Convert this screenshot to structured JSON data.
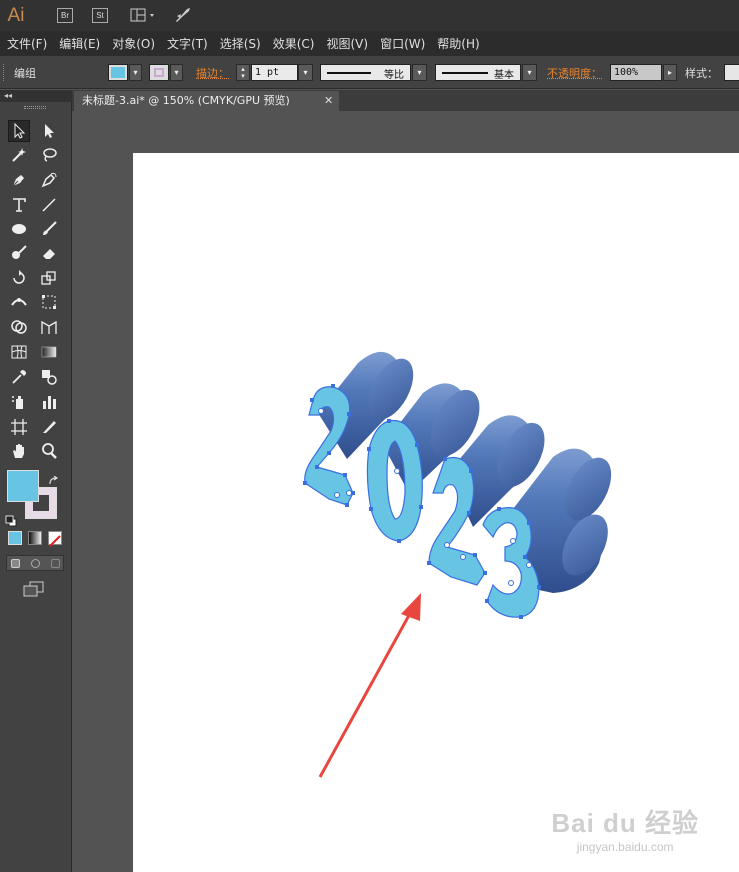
{
  "app": {
    "logo": "Ai",
    "bridge_label": "Br",
    "stock_label": "St"
  },
  "menu": [
    "文件(F)",
    "编辑(E)",
    "对象(O)",
    "文字(T)",
    "选择(S)",
    "效果(C)",
    "视图(V)",
    "窗口(W)",
    "帮助(H)"
  ],
  "control": {
    "group_label": "编组",
    "stroke_label": "描边：",
    "stroke_weight": "1 pt",
    "stroke_profile": "等比",
    "brush": "基本",
    "opacity_label": "不透明度：",
    "opacity": "100%",
    "style_label": "样式："
  },
  "document": {
    "tab_title": "未标题-3.ai* @ 150% (CMYK/GPU 预览)",
    "close": "✕"
  },
  "toolbar": {
    "collapse": "◂◂"
  },
  "colors": {
    "fill": "#68c4e3",
    "stroke": "#e8dbe8",
    "extrude": "#4a6fb0",
    "accent": "#e8842c",
    "arrow": "#e8473f"
  },
  "artwork": {
    "text": "2023"
  },
  "watermark": {
    "brand": "Bai du 经验",
    "url": "jingyan.baidu.com"
  }
}
